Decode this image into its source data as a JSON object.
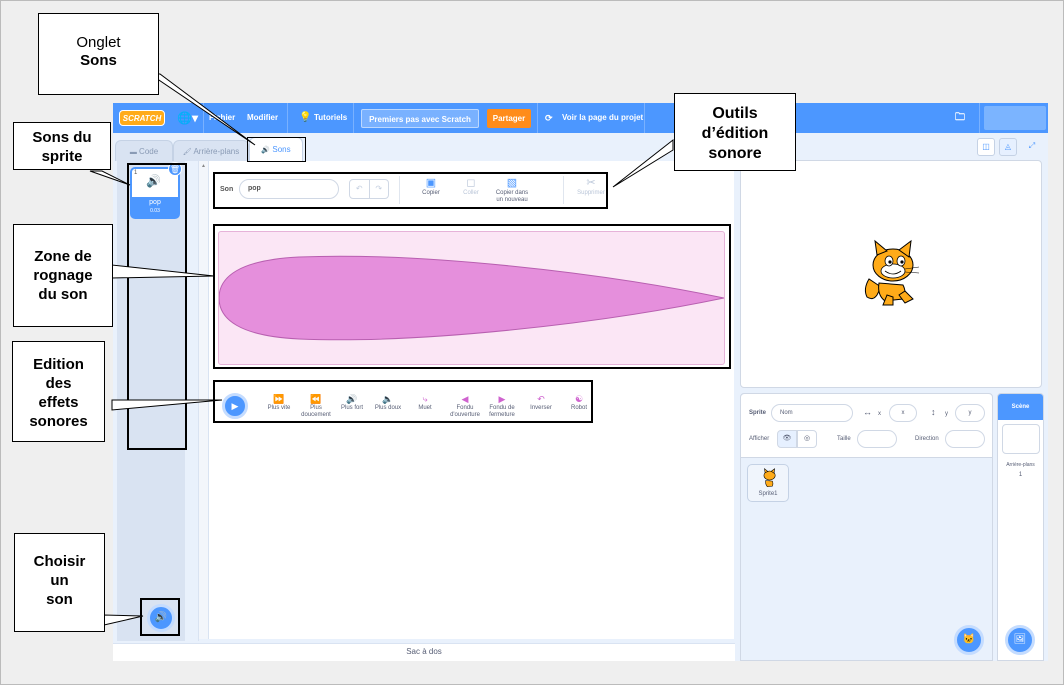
{
  "menubar": {
    "logo": "SCRATCH",
    "file": "Fichier",
    "edit": "Modifier",
    "tutorials": "Tutoriels",
    "project_title": "Premiers pas avec Scratch",
    "share": "Partager",
    "see_project": "Voir la page du projet"
  },
  "tabs": {
    "code": "Code",
    "backdrops": "Arrière-plans",
    "sounds": "Sons"
  },
  "sound_list": {
    "items": [
      {
        "index": "1",
        "name": "pop",
        "duration": "0.03"
      }
    ]
  },
  "editor": {
    "sound_label": "Son",
    "sound_name": "pop",
    "tools": {
      "copy": "Copier",
      "paste": "Coller",
      "copy_new_line1": "Copier dans",
      "copy_new_line2": "un nouveau",
      "delete": "Supprimer"
    },
    "effects": {
      "faster": "Plus vite",
      "slower_line1": "Plus",
      "slower_line2": "doucement",
      "louder": "Plus fort",
      "softer": "Plus doux",
      "mute": "Muet",
      "fade_in_line1": "Fondu",
      "fade_in_line2": "d'ouverture",
      "fade_out_line1": "Fondu de",
      "fade_out_line2": "fermeture",
      "reverse": "Inverser",
      "robot": "Robot"
    },
    "waveform_color": "#e58fdc"
  },
  "backpack": "Sac à dos",
  "sprite_info": {
    "sprite_label": "Sprite",
    "name_placeholder": "Nom",
    "x_label": "x",
    "x_value": "x",
    "y_label": "y",
    "y_value": "y",
    "show_label": "Afficher",
    "size_label": "Taille",
    "direction_label": "Direction",
    "sprite_name": "Sprite1"
  },
  "scene": {
    "title": "Scène",
    "backdrops_label": "Arrière-plans",
    "backdrops_count": "1"
  },
  "annotations": {
    "tab_sounds_line1": "Onglet",
    "tab_sounds_line2": "Sons",
    "sprite_sounds_line1": "Sons du",
    "sprite_sounds_line2": "sprite",
    "trim_line1": "Zone de",
    "trim_line2": "rognage",
    "trim_line3": "du son",
    "effects_line1": "Edition",
    "effects_line2": "des",
    "effects_line3": "effets",
    "effects_line4": "sonores",
    "choose_line1": "Choisir",
    "choose_line2": "un",
    "choose_line3": "son",
    "tools_line1": "Outils",
    "tools_line2": "d’édition",
    "tools_line3": "sonore"
  },
  "colors": {
    "scratch_blue": "#4c97ff",
    "share_orange": "#ff8c1a",
    "logo_orange": "#ffab19",
    "sound_pink": "#cf63cf"
  }
}
